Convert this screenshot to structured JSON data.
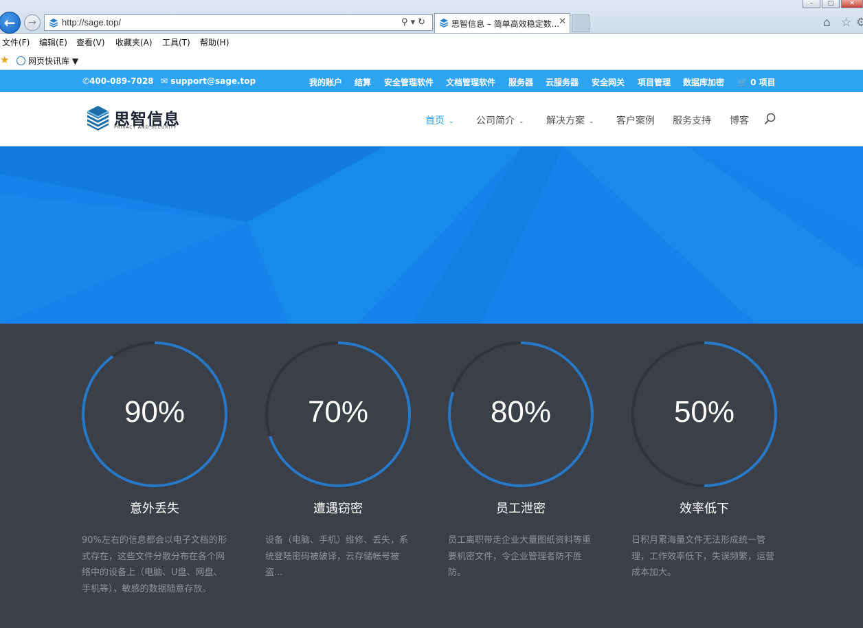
{
  "browser": {
    "url": "http://sage.top/",
    "tab_title": "思智信息 – 简单高效稳定数...",
    "menu": [
      "文件(F)",
      "编辑(E)",
      "查看(V)",
      "收藏夹(A)",
      "工具(T)",
      "帮助(H)"
    ],
    "favorites_link": "网页快讯库"
  },
  "topbar": {
    "phone": "400-089-7028",
    "email": "support@sage.top",
    "links": [
      "我的账户",
      "结算",
      "安全管理软件",
      "文档管理软件",
      "服务器",
      "云服务器",
      "安全网关",
      "项目管理",
      "数据库加密"
    ],
    "cart": "0 项目"
  },
  "header": {
    "logo_text": "思智信息",
    "logo_sub": "PRIVACY AND SECURITY",
    "nav": [
      {
        "label": "首页",
        "dropdown": true,
        "active": true
      },
      {
        "label": "公司简介",
        "dropdown": true,
        "active": false
      },
      {
        "label": "解决方案",
        "dropdown": true,
        "active": false
      },
      {
        "label": "客户案例",
        "dropdown": false,
        "active": false
      },
      {
        "label": "服务支持",
        "dropdown": false,
        "active": false
      },
      {
        "label": "博客",
        "dropdown": false,
        "active": false
      }
    ]
  },
  "stats": [
    {
      "percent": 90,
      "value": "90%",
      "title": "意外丢失",
      "desc": "90%左右的信息都会以电子文档的形式存在，这些文件分散分布在各个网络中的设备上（电脑、U盘、网盘、手机等），敏感的数据随意存放。"
    },
    {
      "percent": 70,
      "value": "70%",
      "title": "遭遇窃密",
      "desc": "设备（电脑、手机）维修、丢失，系统登陆密码被破译，云存储帐号被盗..."
    },
    {
      "percent": 80,
      "value": "80%",
      "title": "员工泄密",
      "desc": "员工离职带走企业大量图纸资料等重要机密文件，令企业管理者防不胜防。"
    },
    {
      "percent": 50,
      "value": "50%",
      "title": "效率低下",
      "desc": "日积月累海量文件无法形成统一管理，工作效率低下，失误频繁，运营成本加大。"
    }
  ],
  "colors": {
    "accent": "#2ea3f2",
    "hero": "#1583e9",
    "ring": "#2878c8",
    "ring_track": "#30343b",
    "stats_bg": "#3b3f47"
  }
}
